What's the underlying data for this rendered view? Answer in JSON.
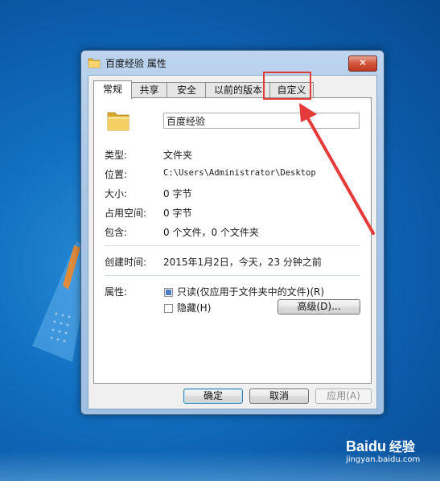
{
  "dialog": {
    "title": "百度经验 属性",
    "close_label": "✕"
  },
  "tabs": [
    {
      "label": "常规",
      "active": true
    },
    {
      "label": "共享",
      "active": false
    },
    {
      "label": "安全",
      "active": false
    },
    {
      "label": "以前的版本",
      "active": false
    },
    {
      "label": "自定义",
      "active": false
    }
  ],
  "general": {
    "name": "百度经验",
    "type_label": "类型:",
    "type_value": "文件夹",
    "location_label": "位置:",
    "location_value": "C:\\Users\\Administrator\\Desktop",
    "size_label": "大小:",
    "size_value": "0 字节",
    "size_on_disk_label": "占用空间:",
    "size_on_disk_value": "0 字节",
    "contains_label": "包含:",
    "contains_value": "0 个文件，0 个文件夹",
    "created_label": "创建时间:",
    "created_value": "2015年1月2日，今天，23 分钟之前",
    "attributes_label": "属性:",
    "readonly_label": "只读(仅应用于文件夹中的文件)(R)",
    "readonly_checked": true,
    "hidden_label": "隐藏(H)",
    "hidden_checked": false,
    "advanced_button": "高级(D)..."
  },
  "footer": {
    "ok": "确定",
    "cancel": "取消",
    "apply": "应用(A)"
  },
  "watermark": {
    "brand": "Baidu",
    "brand_cn": "经验",
    "url": "jingyan.baidu.com"
  },
  "colors": {
    "annotation": "#e53a3a",
    "desktop": "#1270c2",
    "folder": "#f2c94c"
  }
}
